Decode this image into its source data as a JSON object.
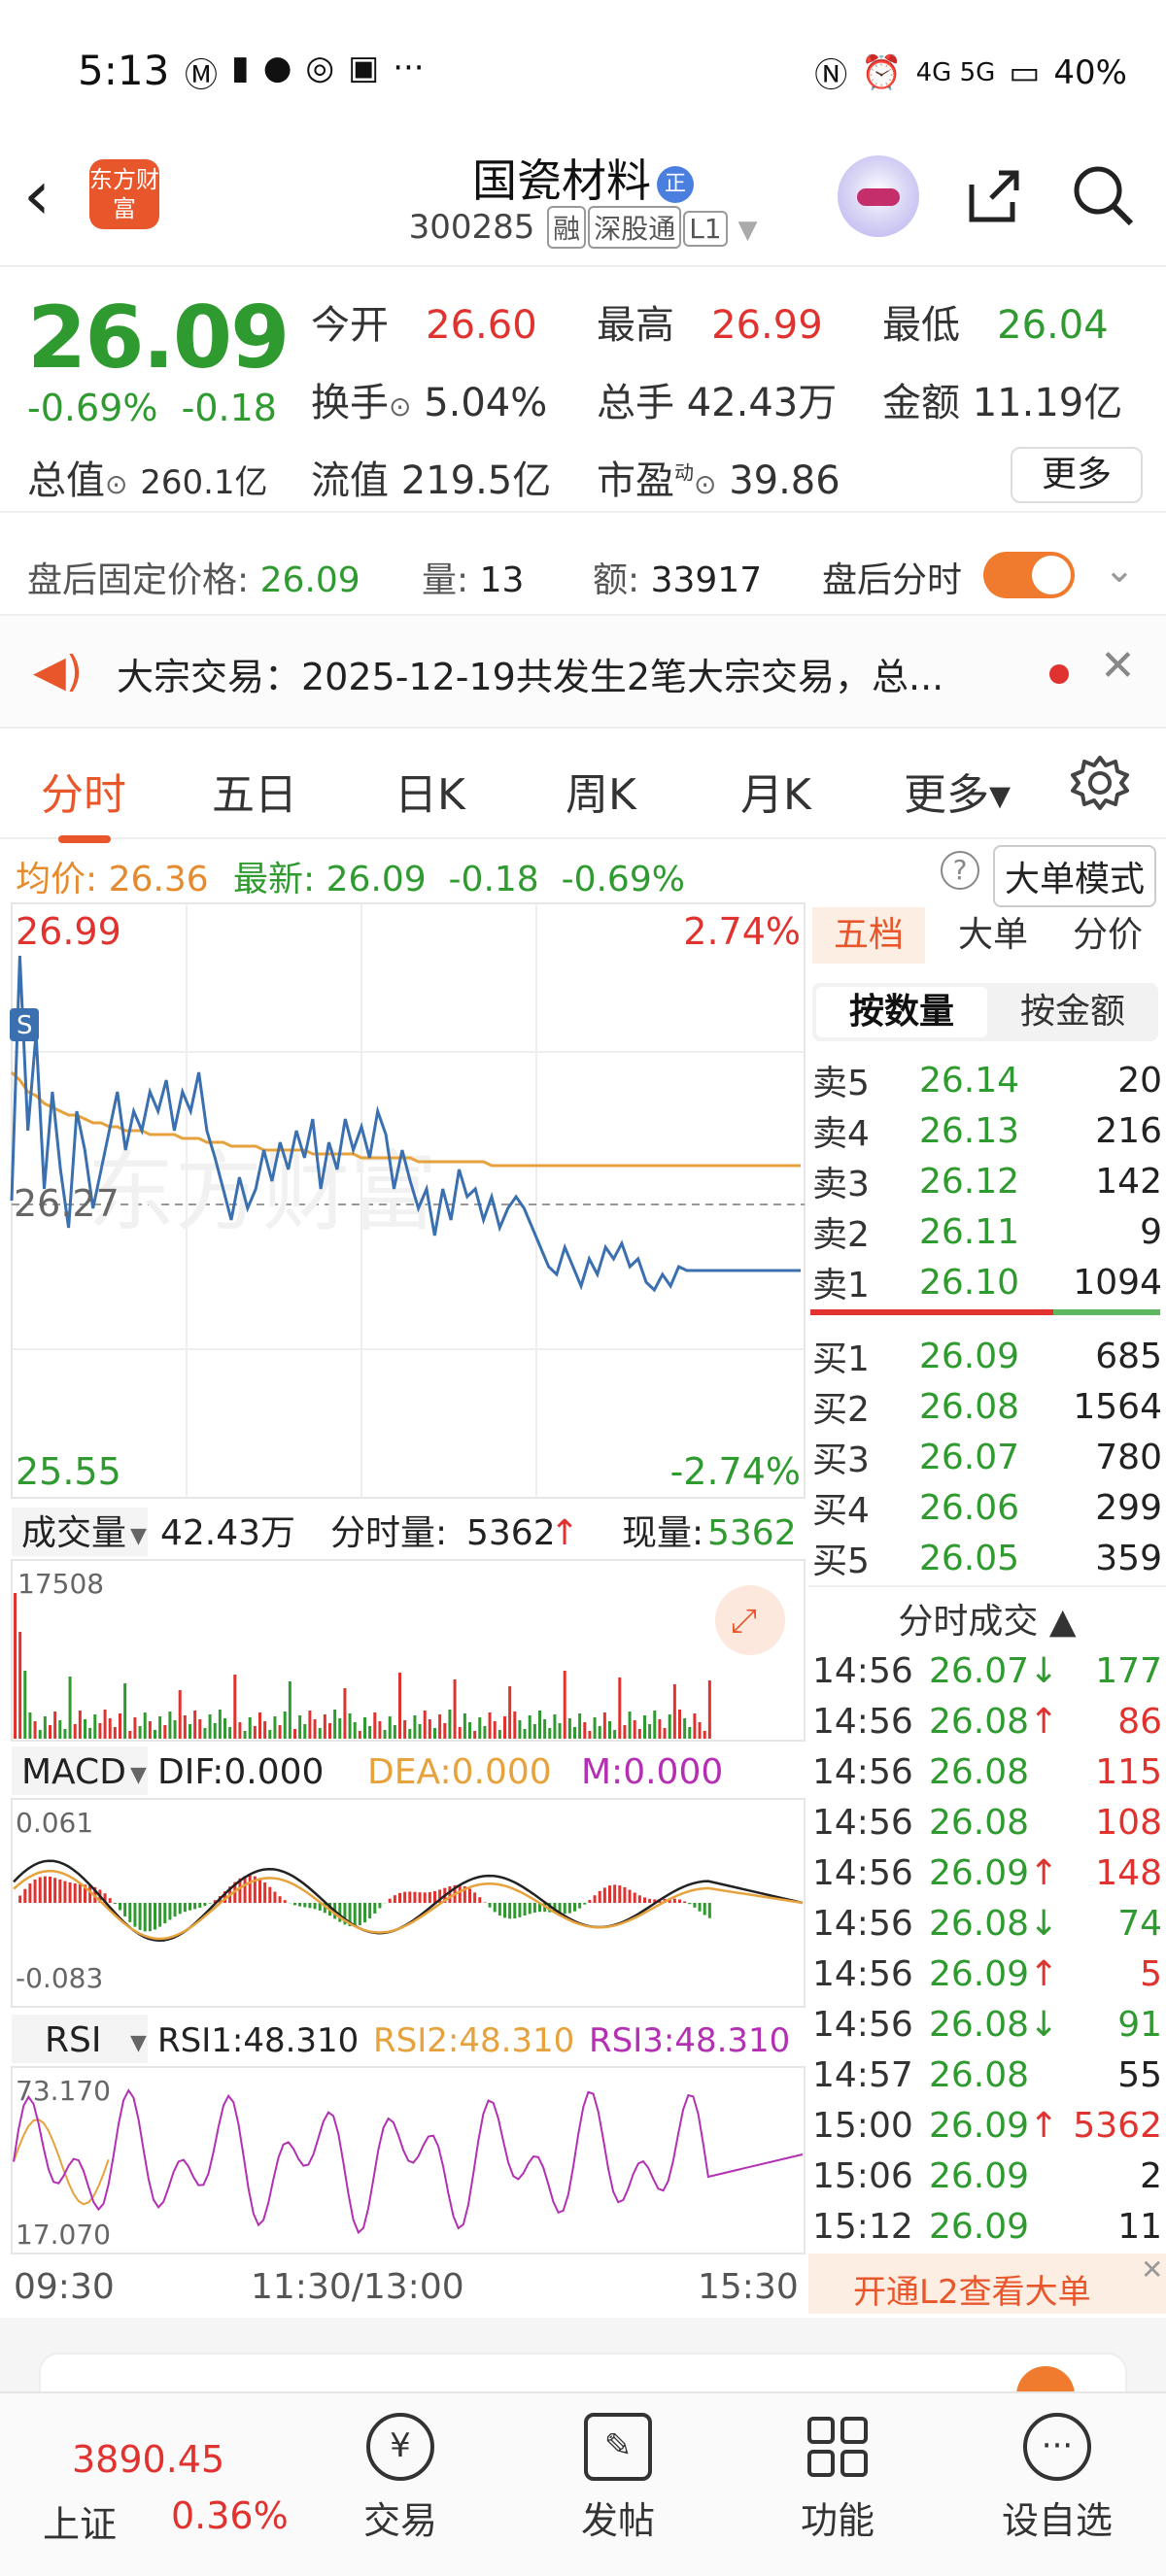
{
  "status_bar": {
    "time": "5:13",
    "network": "4G 5G",
    "battery": "40%"
  },
  "header": {
    "logo_text": "东方财富",
    "stock_name": "国瓷材料",
    "name_badge": "正",
    "stock_code": "300285",
    "tags": [
      "融",
      "深股通",
      "L1"
    ]
  },
  "quote": {
    "price": "26.09",
    "change_pct": "-0.69%",
    "change": "-0.18",
    "open_label": "今开",
    "open": "26.60",
    "high_label": "最高",
    "high": "26.99",
    "low_label": "最低",
    "low": "26.04",
    "turnover_label": "换手",
    "turnover": "5.04%",
    "volume_label": "总手",
    "volume": "42.43万",
    "amount_label": "金额",
    "amount": "11.19亿",
    "mktcap_label": "总值",
    "mktcap": "260.1亿",
    "float_label": "流值",
    "float": "219.5亿",
    "pe_label": "市盈",
    "pe_sup": "动",
    "pe": "39.86",
    "more_button": "更多"
  },
  "after_hours": {
    "price_label": "盘后固定价格:",
    "price": "26.09",
    "vol_label": "量:",
    "vol": "13",
    "amt_label": "额:",
    "amt": "33917",
    "toggle_label": "盘后分时",
    "toggle_on": true
  },
  "notice": {
    "text": "大宗交易：2025-12-19共发生2笔大宗交易，总..."
  },
  "tabs": [
    {
      "label": "分时",
      "active": true
    },
    {
      "label": "五日"
    },
    {
      "label": "日K"
    },
    {
      "label": "周K"
    },
    {
      "label": "月K"
    },
    {
      "label": "更多▾"
    }
  ],
  "avg_info": {
    "avg_label": "均价:",
    "avg": "26.36",
    "last_label": "最新:",
    "last": "26.09",
    "chg": "-0.18",
    "pct": "-0.69%",
    "mode_button": "大单模式"
  },
  "chart_data": {
    "type": "line",
    "price_max": "26.99",
    "price_mid": "26.27",
    "price_min": "25.55",
    "pct_max": "2.74%",
    "pct_min": "-2.74%",
    "ylim": [
      25.55,
      26.99
    ],
    "price_series": [
      26.27,
      26.9,
      26.45,
      26.7,
      26.3,
      26.55,
      26.35,
      26.2,
      26.5,
      26.4,
      26.25,
      26.35,
      26.45,
      26.55,
      26.4,
      26.5,
      26.45,
      26.55,
      26.5,
      26.58,
      26.45,
      26.55,
      26.5,
      26.6,
      26.45,
      26.38,
      26.3,
      26.22,
      26.33,
      26.25,
      26.3,
      26.4,
      26.32,
      26.42,
      26.35,
      26.45,
      26.38,
      26.48,
      26.3,
      26.42,
      26.35,
      26.48,
      26.4,
      26.46,
      26.38,
      26.5,
      26.44,
      26.3,
      26.4,
      26.32,
      26.25,
      26.3,
      26.18,
      26.3,
      26.22,
      26.35,
      26.28,
      26.3,
      26.22,
      26.28,
      26.2,
      26.25,
      26.28,
      26.25,
      26.2,
      26.15,
      26.1,
      26.08,
      26.15,
      26.1,
      26.05,
      26.12,
      26.08,
      26.15,
      26.12,
      26.16,
      26.1,
      26.12,
      26.06,
      26.04,
      26.08,
      26.05,
      26.1,
      26.09,
      26.09,
      26.09,
      26.09
    ],
    "avg_series": [
      26.6,
      26.58,
      26.55,
      26.54,
      26.52,
      26.51,
      26.5,
      26.49,
      26.49,
      26.48,
      26.47,
      26.47,
      26.46,
      26.46,
      26.45,
      26.45,
      26.45,
      26.44,
      26.44,
      26.44,
      26.44,
      26.43,
      26.43,
      26.43,
      26.42,
      26.42,
      26.42,
      26.41,
      26.41,
      26.41,
      26.41,
      26.4,
      26.4,
      26.4,
      26.4,
      26.4,
      26.4,
      26.39,
      26.39,
      26.39,
      26.39,
      26.39,
      26.39,
      26.38,
      26.38,
      26.38,
      26.38,
      26.38,
      26.38,
      26.38,
      26.37,
      26.37,
      26.37,
      26.37,
      26.37,
      26.37,
      26.37,
      26.37,
      26.37,
      26.36,
      26.36,
      26.36,
      26.36,
      26.36,
      26.36,
      26.36,
      26.36,
      26.36,
      26.36,
      26.36,
      26.36,
      26.36,
      26.36,
      26.36,
      26.36,
      26.36,
      26.36,
      26.36,
      26.36,
      26.36,
      26.36,
      26.36,
      26.36,
      26.36,
      26.36,
      26.36,
      26.36
    ],
    "volume_label": "成交量",
    "volume_total": "42.43万",
    "minute_vol_label": "分时量:",
    "minute_vol": "5362",
    "current_vol_label": "现量:",
    "current_vol": "5362",
    "volume_max": "17508",
    "macd_label": "MACD",
    "dif": "DIF:0.000",
    "dea": "DEA:0.000",
    "m": "M:0.000",
    "macd_max": "0.061",
    "macd_min": "-0.083",
    "rsi_label": "RSI",
    "rsi1": "RSI1:48.310",
    "rsi2": "RSI2:48.310",
    "rsi3": "RSI3:48.310",
    "rsi_max": "73.170",
    "rsi_min": "17.070"
  },
  "time_axis": [
    "09:30",
    "11:30/13:00",
    "15:30"
  ],
  "pankou": {
    "tab_wudang": "五档",
    "tab_dadan": "大单",
    "tab_fenjia": "分价",
    "sub_by_qty": "按数量",
    "sub_by_amt": "按金额",
    "sells": [
      {
        "label": "卖5",
        "price": "26.14",
        "vol": "20"
      },
      {
        "label": "卖4",
        "price": "26.13",
        "vol": "216"
      },
      {
        "label": "卖3",
        "price": "26.12",
        "vol": "142"
      },
      {
        "label": "卖2",
        "price": "26.11",
        "vol": "9"
      },
      {
        "label": "卖1",
        "price": "26.10",
        "vol": "1094"
      }
    ],
    "buys": [
      {
        "label": "买1",
        "price": "26.09",
        "vol": "685"
      },
      {
        "label": "买2",
        "price": "26.08",
        "vol": "1564"
      },
      {
        "label": "买3",
        "price": "26.07",
        "vol": "780"
      },
      {
        "label": "买4",
        "price": "26.06",
        "vol": "299"
      },
      {
        "label": "买5",
        "price": "26.05",
        "vol": "359"
      }
    ],
    "ticks_title": "分时成交 ▲",
    "ticks": [
      {
        "time": "14:56",
        "price": "26.07",
        "arrow": "↓",
        "vol": "177",
        "vol_color": "#2f9a2f"
      },
      {
        "time": "14:56",
        "price": "26.08",
        "arrow": "↑",
        "vol": "86",
        "vol_color": "#e0332f"
      },
      {
        "time": "14:56",
        "price": "26.08",
        "arrow": "",
        "vol": "115",
        "vol_color": "#e0332f"
      },
      {
        "time": "14:56",
        "price": "26.08",
        "arrow": "",
        "vol": "108",
        "vol_color": "#e0332f"
      },
      {
        "time": "14:56",
        "price": "26.09",
        "arrow": "↑",
        "vol": "148",
        "vol_color": "#e0332f"
      },
      {
        "time": "14:56",
        "price": "26.08",
        "arrow": "↓",
        "vol": "74",
        "vol_color": "#2f9a2f"
      },
      {
        "time": "14:56",
        "price": "26.09",
        "arrow": "↑",
        "vol": "5",
        "vol_color": "#e0332f"
      },
      {
        "time": "14:56",
        "price": "26.08",
        "arrow": "↓",
        "vol": "91",
        "vol_color": "#2f9a2f"
      },
      {
        "time": "14:57",
        "price": "26.08",
        "arrow": "",
        "vol": "55",
        "vol_color": "#222222"
      },
      {
        "time": "15:00",
        "price": "26.09",
        "arrow": "↑",
        "vol": "5362",
        "vol_color": "#e0332f"
      },
      {
        "time": "15:06",
        "price": "26.09",
        "arrow": "",
        "vol": "2",
        "vol_color": "#222222"
      },
      {
        "time": "15:12",
        "price": "26.09",
        "arrow": "",
        "vol": "11",
        "vol_color": "#222222"
      }
    ],
    "l2_banner": "开通L2查看大单"
  },
  "bottom_nav": {
    "index_value": "3890.45",
    "index_name": "上证",
    "index_pct": "0.36%",
    "items": [
      "交易",
      "发帖",
      "功能",
      "设自选"
    ]
  },
  "colors": {
    "up": "#e0332f",
    "down": "#2f9a2f",
    "accent": "#e8572c",
    "avg_line": "#e6a23c",
    "price_line": "#3a6fb0"
  }
}
